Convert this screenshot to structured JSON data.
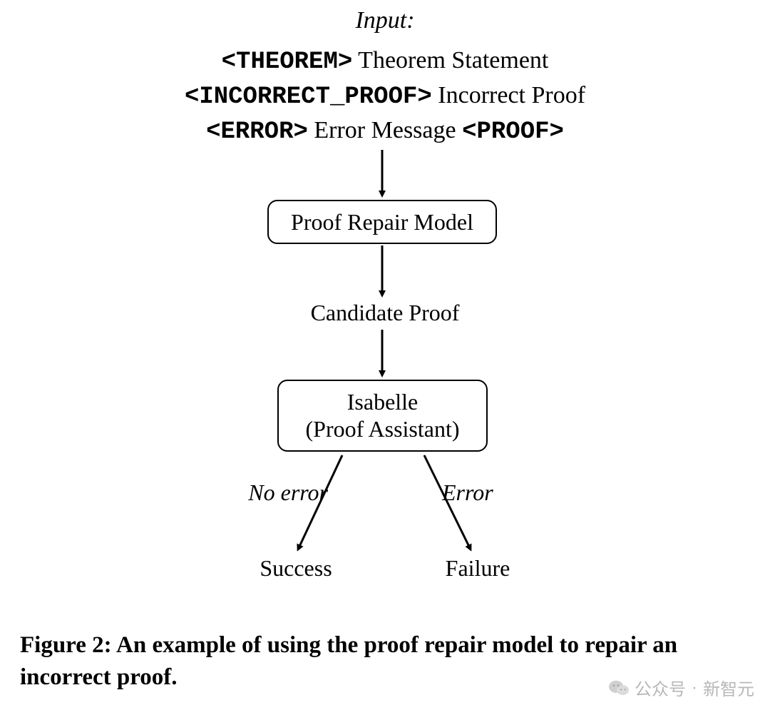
{
  "input_title": "Input:",
  "input_lines": [
    {
      "token": "<THEOREM>",
      "text": "Theorem Statement",
      "tail": ""
    },
    {
      "token": "<INCORRECT_PROOF>",
      "text": "Incorrect Proof",
      "tail": ""
    },
    {
      "token": "<ERROR>",
      "text": "Error Message",
      "tail": "<PROOF>"
    }
  ],
  "nodes": {
    "repair_model": "Proof Repair Model",
    "candidate": "Candidate Proof",
    "isabelle_line1": "Isabelle",
    "isabelle_line2": "(Proof Assistant)",
    "no_error": "No error",
    "error": "Error",
    "success": "Success",
    "failure": "Failure"
  },
  "caption": "Figure 2: An example of using the proof repair model to repair an incorrect proof.",
  "watermark": {
    "label": "公众号",
    "dot": "·",
    "source": "新智元"
  }
}
